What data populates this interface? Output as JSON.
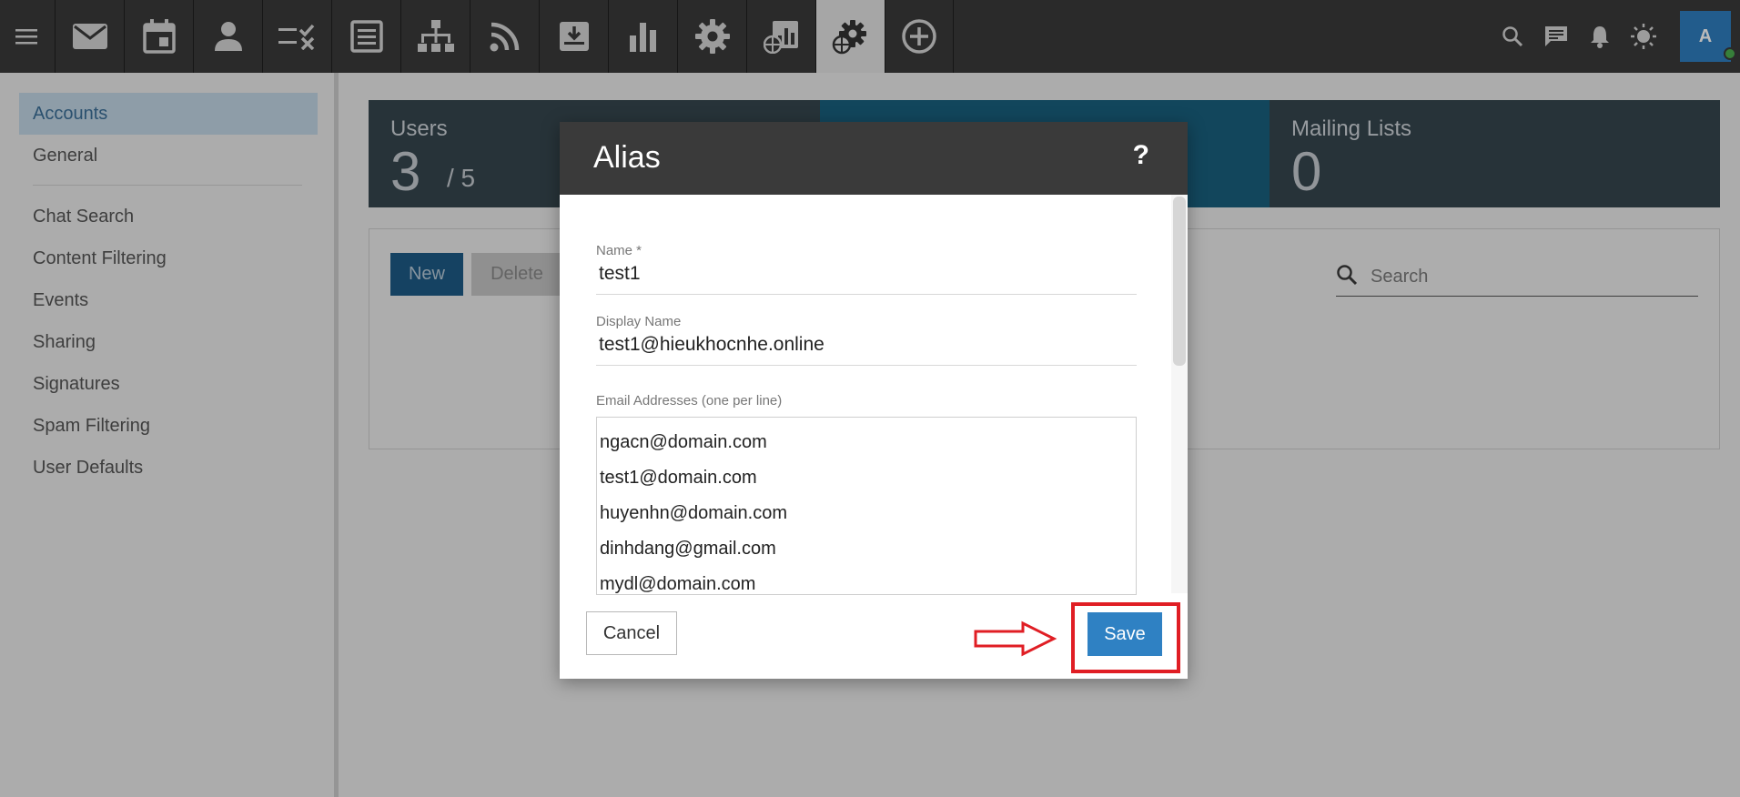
{
  "topbar": {
    "tools": [
      {
        "icon": "mail-icon"
      },
      {
        "icon": "calendar-icon"
      },
      {
        "icon": "contacts-icon"
      },
      {
        "icon": "tasks-icon"
      },
      {
        "icon": "notes-icon"
      },
      {
        "icon": "sitemap-icon"
      },
      {
        "icon": "rss-icon"
      },
      {
        "icon": "archive-icon"
      },
      {
        "icon": "reports-icon"
      },
      {
        "icon": "settings-icon"
      },
      {
        "icon": "domain-reports-icon"
      },
      {
        "icon": "domain-settings-icon",
        "active": true
      },
      {
        "icon": "add-circle-icon"
      }
    ],
    "avatar_letter": "A"
  },
  "sidebar": {
    "items": [
      {
        "label": "Accounts",
        "active": true
      },
      {
        "label": "General"
      },
      {
        "label": "Chat Search"
      },
      {
        "label": "Content Filtering"
      },
      {
        "label": "Events"
      },
      {
        "label": "Sharing"
      },
      {
        "label": "Signatures"
      },
      {
        "label": "Spam Filtering"
      },
      {
        "label": "User Defaults"
      }
    ]
  },
  "stats": {
    "users_label": "Users",
    "users_value": "3",
    "users_max": "/ 5",
    "mailing_label": "Mailing Lists",
    "mailing_value": "0"
  },
  "toolbar": {
    "new_label": "New",
    "delete_label": "Delete",
    "search_placeholder": "Search"
  },
  "modal": {
    "title": "Alias",
    "help": "?",
    "name_label": "Name *",
    "name_value": "test1",
    "display_label": "Display Name",
    "display_value": "test1@hieukhocnhe.online",
    "emails_label": "Email Addresses (one per line)",
    "emails": [
      "ngacn@domain.com",
      "test1@domain.com",
      "huyenhn@domain.com",
      "dinhdang@gmail.com",
      "mydl@domain.com"
    ],
    "cancel_label": "Cancel",
    "save_label": "Save"
  },
  "colors": {
    "topbar": "#3a3a3a",
    "accent": "#2f81c3",
    "highlight": "#e01e24"
  }
}
